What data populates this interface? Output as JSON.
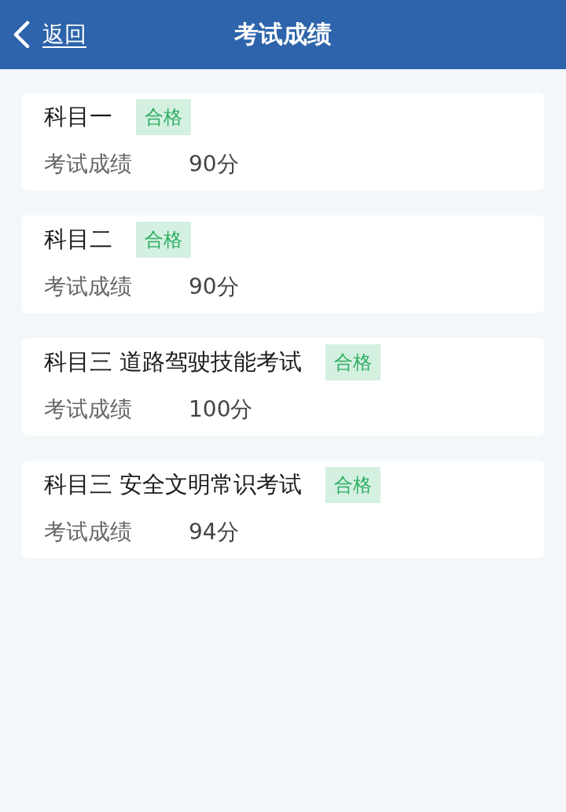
{
  "header": {
    "back": "返回",
    "title": "考试成绩"
  },
  "results": [
    {
      "subject": "科目一",
      "status": {
        "kind": "pass",
        "label": "合格"
      },
      "score_label": "考试成绩",
      "score": "90分"
    },
    {
      "subject": "科目二",
      "status": {
        "kind": "pass",
        "label": "合格"
      },
      "score_label": "考试成绩",
      "score": "90分"
    },
    {
      "subject": "科目三 道路驾驶技能考试",
      "status": {
        "kind": "pass",
        "label": "合格"
      },
      "score_label": "考试成绩",
      "score": "100分"
    },
    {
      "subject": "科目三 安全文明常识考试",
      "status": {
        "kind": "pass",
        "label": "合格"
      },
      "score_label": "考试成绩",
      "score": "94分"
    }
  ]
}
